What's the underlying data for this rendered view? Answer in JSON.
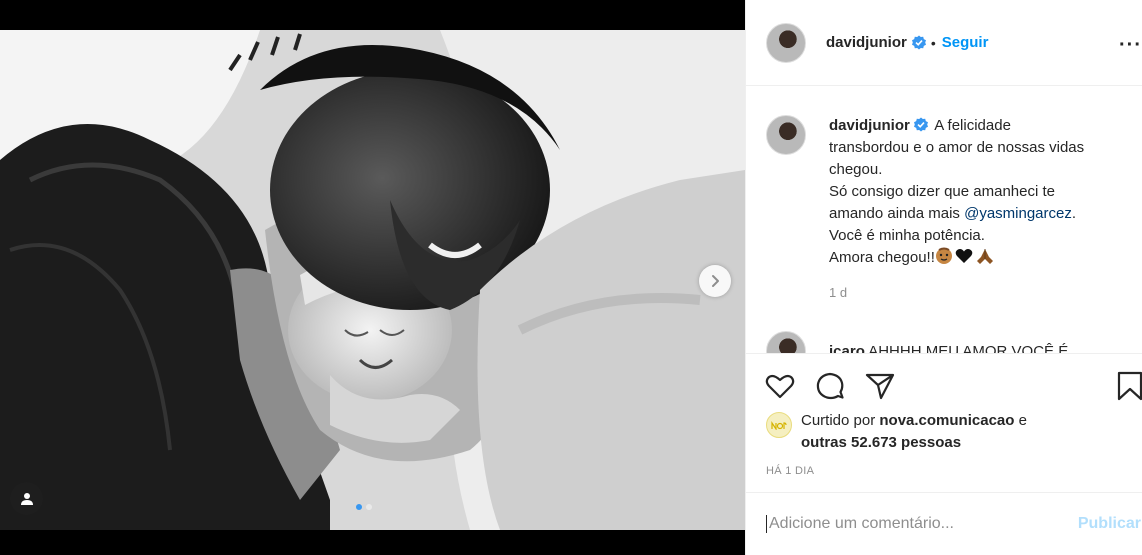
{
  "post": {
    "author": "davidjunior",
    "follow_label": "Seguir",
    "separator": "•",
    "more_label": "···"
  },
  "caption": {
    "author": "davidjunior",
    "line1": "A felicidade",
    "line2": "transbordou e o amor de nossas vidas",
    "line3": "chegou.",
    "line4": "Só consigo dizer que amanheci te",
    "line5_prefix": "amando ainda mais",
    "mention": "@yasmingarcez",
    "line5_suffix": ".",
    "line6": "Você é minha potência.",
    "line7": "Amora chegou!!",
    "time": "1 d"
  },
  "next_comment": {
    "author": "icaro",
    "text": "AHHHH MEU AMOR VOCÊ É"
  },
  "likes": {
    "prefix": "Curtido por",
    "user": "nova.comunicacao",
    "conj": "e",
    "others": "outras 52.673 pessoas"
  },
  "posted_ago": "HÁ 1 DIA",
  "comment_input": {
    "placeholder": "Adicione um comentário..."
  },
  "publish_label": "Publicar",
  "carousel": {
    "count": 2,
    "active_index": 0
  },
  "colors": {
    "accent": "#0095f6",
    "verified": "#3897f0",
    "publish_disabled": "#b2dffc"
  }
}
